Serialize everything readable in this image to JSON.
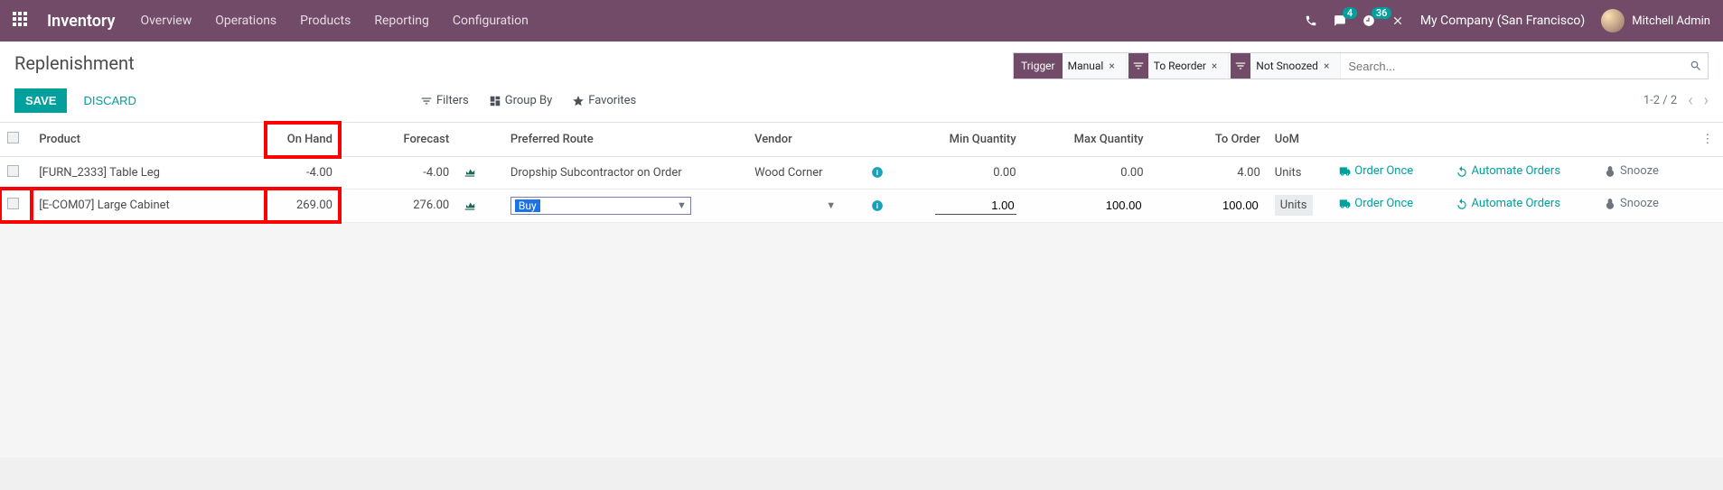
{
  "navbar": {
    "brand": "Inventory",
    "items": [
      "Overview",
      "Operations",
      "Products",
      "Reporting",
      "Configuration"
    ],
    "messages_badge": "4",
    "activity_badge": "36",
    "company": "My Company (San Francisco)",
    "user": "Mitchell Admin"
  },
  "breadcrumb": "Replenishment",
  "buttons": {
    "save": "SAVE",
    "discard": "DISCARD"
  },
  "search": {
    "trigger_label": "Trigger",
    "facets": [
      {
        "type": "trigger",
        "value": "Manual"
      },
      {
        "type": "filter",
        "value": "To Reorder"
      },
      {
        "type": "filter",
        "value": "Not Snoozed"
      }
    ],
    "placeholder": "Search...",
    "tools": {
      "filters": "Filters",
      "groupby": "Group By",
      "favorites": "Favorites"
    }
  },
  "pager": {
    "range": "1-2 / 2"
  },
  "columns": {
    "product": "Product",
    "on_hand": "On Hand",
    "forecast": "Forecast",
    "route": "Preferred Route",
    "vendor": "Vendor",
    "min": "Min Quantity",
    "max": "Max Quantity",
    "to_order": "To Order",
    "uom": "UoM"
  },
  "rows": [
    {
      "product": "[FURN_2333] Table Leg",
      "on_hand": "-4.00",
      "forecast": "-4.00",
      "route": "Dropship Subcontractor on Order",
      "vendor": "Wood Corner",
      "min": "0.00",
      "max": "0.00",
      "to_order": "4.00",
      "uom": "Units"
    },
    {
      "product": "[E-COM07] Large Cabinet",
      "on_hand": "269.00",
      "forecast": "276.00",
      "route": "Buy",
      "vendor": "",
      "min": "1.00",
      "max": "100.00",
      "to_order": "100.00",
      "uom": "Units"
    }
  ],
  "actions": {
    "order_once": "Order Once",
    "automate": "Automate Orders",
    "snooze": "Snooze"
  }
}
